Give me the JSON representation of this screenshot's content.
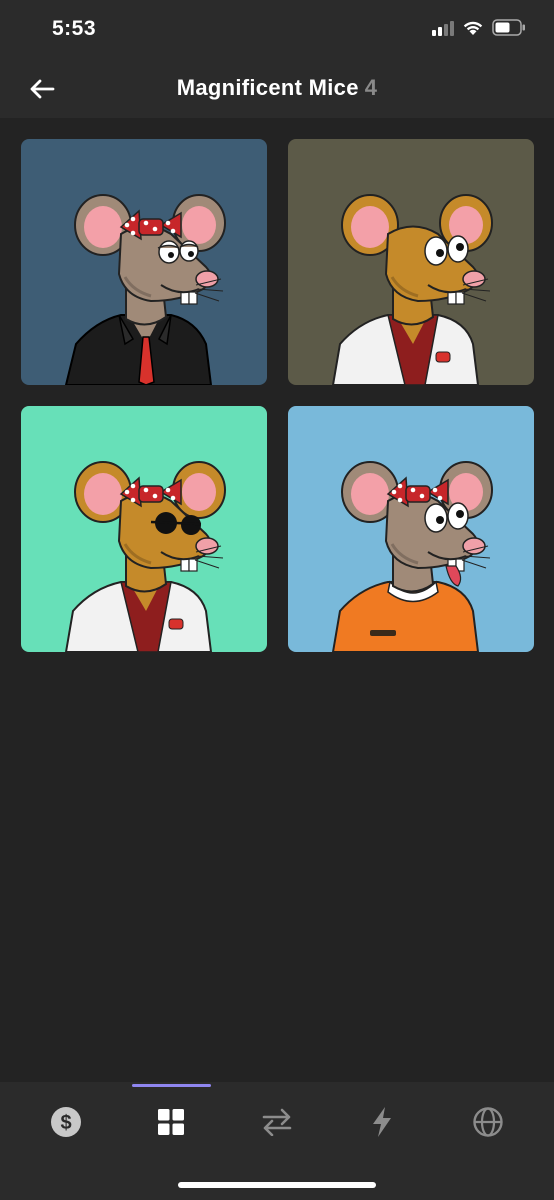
{
  "status_bar": {
    "time": "5:53",
    "icons": [
      "cellular-signal-icon",
      "wifi-icon",
      "battery-icon"
    ]
  },
  "header": {
    "back_icon": "arrow-left-icon",
    "title": "Magnificent Mice",
    "count": "4"
  },
  "collection": {
    "items": [
      {
        "background": "#3e5d75",
        "fur": "#a08a78",
        "accessory": "bow",
        "eyes": "sleepy",
        "outfit": "black-shirt-red-tie"
      },
      {
        "background": "#5c5a48",
        "fur": "#c58a2a",
        "accessory": "none",
        "eyes": "wide",
        "outfit": "white-coat"
      },
      {
        "background": "#67e0b8",
        "fur": "#c58a2a",
        "accessory": "bow",
        "eyes": "sunglasses",
        "outfit": "white-coat"
      },
      {
        "background": "#79b9da",
        "fur": "#a08a78",
        "accessory": "bow",
        "eyes": "crazy",
        "outfit": "orange-jumpsuit"
      }
    ]
  },
  "bottom_nav": {
    "accent": "#8f86f0",
    "active_index": 1,
    "items": [
      {
        "icon": "dollar-coin-icon"
      },
      {
        "icon": "grid-icon"
      },
      {
        "icon": "swap-arrows-icon"
      },
      {
        "icon": "lightning-icon"
      },
      {
        "icon": "globe-icon"
      }
    ]
  }
}
